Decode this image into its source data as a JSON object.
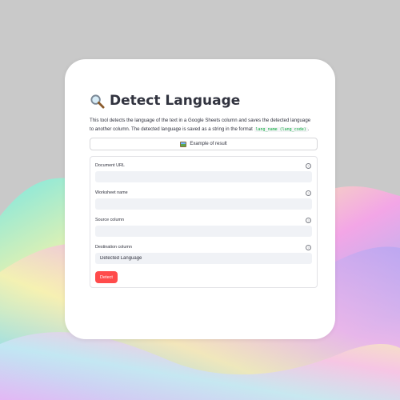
{
  "header": {
    "title": "Detect Language",
    "title_icon": "magnifier-icon"
  },
  "description": {
    "text": "This tool detects the language of the text in a Google Sheets column and saves the detected language to another column. The detected language is saved as a string in the format",
    "code": "lang_name (lang_code)",
    "suffix": "."
  },
  "example_button": {
    "icon": "image-icon",
    "label": "Example of result"
  },
  "form": {
    "fields": [
      {
        "label": "Document URL",
        "value": "",
        "placeholder": ""
      },
      {
        "label": "Worksheet name",
        "value": "",
        "placeholder": ""
      },
      {
        "label": "Source column",
        "value": "",
        "placeholder": ""
      },
      {
        "label": "Destination column",
        "value": "Detected Language",
        "placeholder": ""
      }
    ],
    "help_icon": "?",
    "submit_label": "Detect"
  },
  "colors": {
    "accent": "#ff4b4b",
    "code": "#09ab3b",
    "input_bg": "#f0f2f6",
    "text": "#31333f"
  }
}
